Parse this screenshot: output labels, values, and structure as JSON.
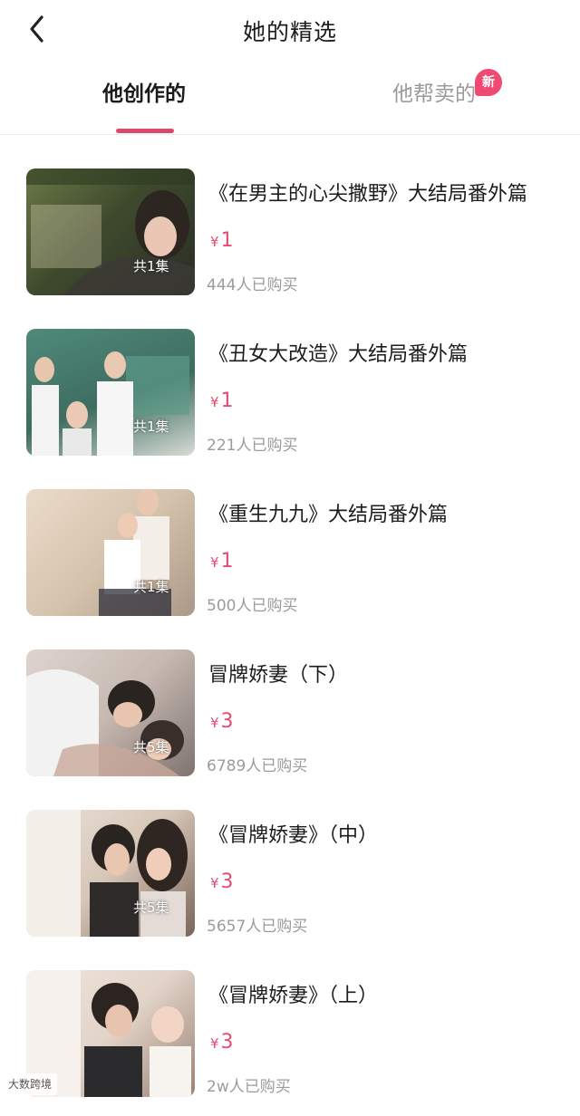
{
  "header": {
    "title": "她的精选",
    "back_icon": "chevron-left-icon"
  },
  "tabs": [
    {
      "label": "他创作的",
      "active": true
    },
    {
      "label": "他帮卖的",
      "active": false,
      "badge": "新"
    }
  ],
  "colors": {
    "accent": "#e84a72",
    "badge": "#f04a72",
    "tab_indicator": "#d84a6b"
  },
  "items": [
    {
      "title": "《在男主的心尖撒野》大结局番外篇",
      "price_symbol": "¥",
      "price": "1",
      "sold": "444人已购买",
      "episodes": "共1集"
    },
    {
      "title": "《丑女大改造》大结局番外篇",
      "price_symbol": "¥",
      "price": "1",
      "sold": "221人已购买",
      "episodes": "共1集"
    },
    {
      "title": "《重生九九》大结局番外篇",
      "price_symbol": "¥",
      "price": "1",
      "sold": "500人已购买",
      "episodes": "共1集"
    },
    {
      "title": "冒牌娇妻（下）",
      "price_symbol": "¥",
      "price": "3",
      "sold": "6789人已购买",
      "episodes": "共5集"
    },
    {
      "title": "《冒牌娇妻》（中）",
      "price_symbol": "¥",
      "price": "3",
      "sold": "5657人已购买",
      "episodes": "共5集"
    },
    {
      "title": "《冒牌娇妻》（上）",
      "price_symbol": "¥",
      "price": "3",
      "sold": "2w人已购买",
      "episodes": ""
    }
  ],
  "watermark": "大数跨境"
}
